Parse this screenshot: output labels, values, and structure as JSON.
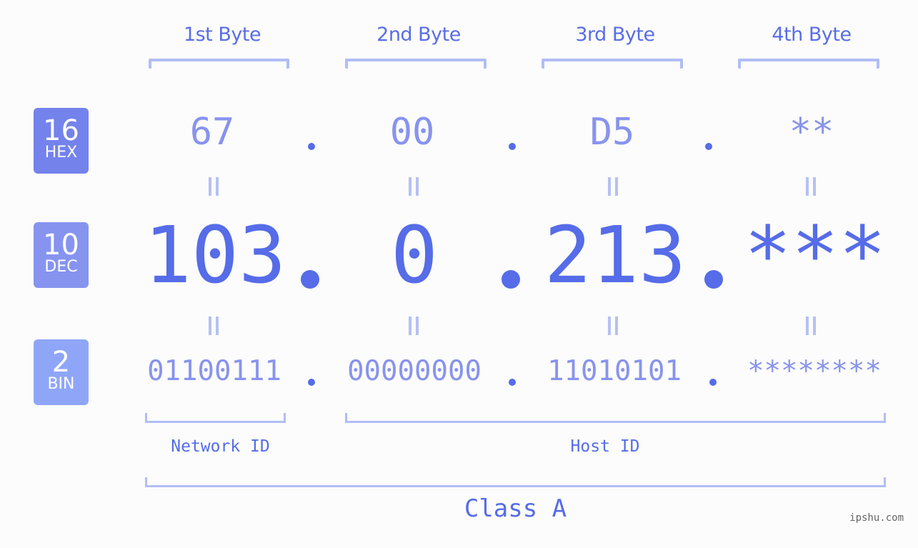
{
  "bytes": {
    "headers": [
      "1st Byte",
      "2nd Byte",
      "3rd Byte",
      "4th Byte"
    ]
  },
  "badges": {
    "hex": {
      "number": "16",
      "label": "HEX",
      "color": "#7482ec"
    },
    "dec": {
      "number": "10",
      "label": "DEC",
      "color": "#8694f0"
    },
    "bin": {
      "number": "2",
      "label": "BIN",
      "color": "#8fa6f8"
    }
  },
  "hex_values": [
    "67",
    "00",
    "D5",
    "**"
  ],
  "dec_values": [
    "103",
    "0",
    "213",
    "***"
  ],
  "bin_values": [
    "01100111",
    "00000000",
    "11010101",
    "********"
  ],
  "separator": ".",
  "segments": {
    "network_id": "Network ID",
    "host_id": "Host ID",
    "class": "Class A"
  },
  "watermark": "ipshu.com",
  "colors": {
    "accent": "#566ce8",
    "light_accent": "#8893ee",
    "bracket": "#b2bdf6",
    "background": "#fbfcfb"
  }
}
